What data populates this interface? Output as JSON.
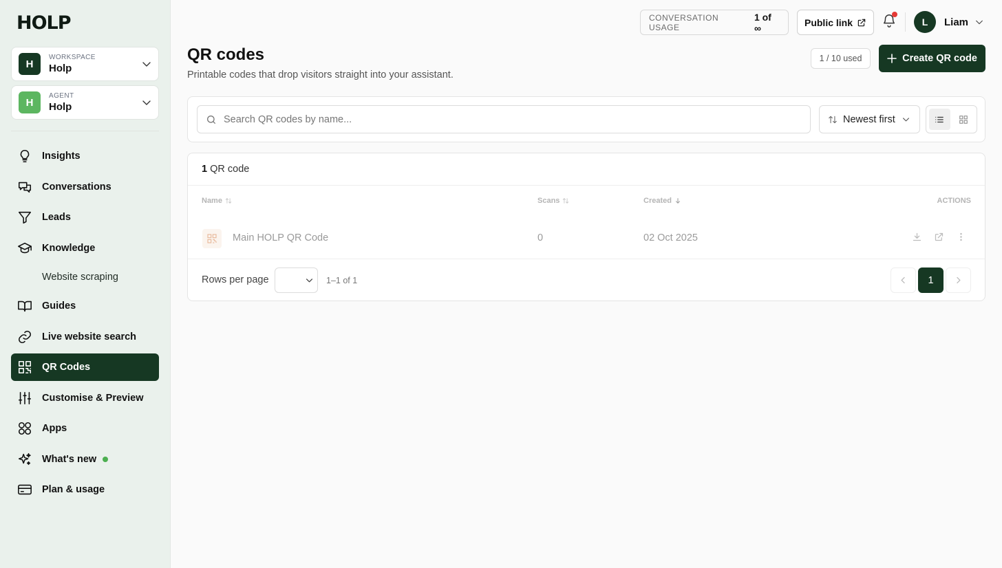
{
  "brand": {
    "logo_text": "HOLP"
  },
  "workspace": {
    "caption": "WORKSPACE",
    "initial": "H",
    "name": "Holp",
    "color": "#163823"
  },
  "agent": {
    "caption": "AGENT",
    "initial": "H",
    "name": "Holp",
    "color": "#5cb660"
  },
  "nav": {
    "insights": "Insights",
    "conversations": "Conversations",
    "leads": "Leads",
    "knowledge": "Knowledge",
    "website_scraping": "Website scraping",
    "guides": "Guides",
    "live_search": "Live website search",
    "qr_codes": "QR Codes",
    "customise": "Customise & Preview",
    "apps": "Apps",
    "whats_new": "What's new",
    "plan": "Plan & usage"
  },
  "topbar": {
    "usage_label": "CONVERSATION USAGE",
    "usage_value": "1 of ∞",
    "public_link": "Public link",
    "user_initial": "L",
    "user_name": "Liam"
  },
  "page": {
    "title": "QR codes",
    "subtitle": "Printable codes that drop visitors straight into your assistant.",
    "used": "1 / 10 used",
    "create_label": "Create QR code"
  },
  "filters": {
    "search_placeholder": "Search QR codes by name...",
    "sort_label": "Newest first",
    "view_active": "list"
  },
  "table": {
    "count_number": "1",
    "count_suffix": "QR code",
    "columns": {
      "name": "Name",
      "scans": "Scans",
      "created": "Created",
      "actions": "ACTIONS"
    },
    "rows": [
      {
        "name": "Main HOLP QR Code",
        "scans": "0",
        "created": "02 Oct 2025"
      }
    ]
  },
  "pagination": {
    "rows_per_page_label": "Rows per page",
    "range": "1–1 of 1",
    "current_page": "1"
  },
  "colors": {
    "primary": "#163823",
    "sidebar_bg": "#eaf1ec",
    "notification_dot": "#e53935",
    "new_dot": "#4caf50"
  }
}
